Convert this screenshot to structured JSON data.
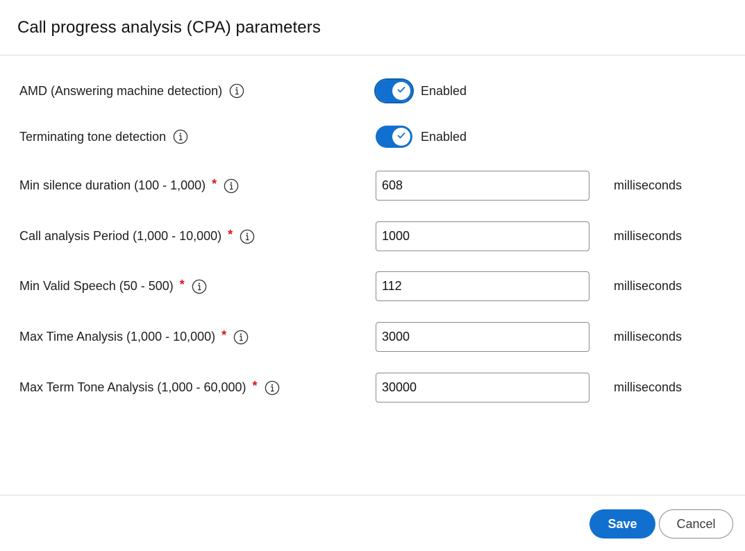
{
  "dialog": {
    "title": "Call progress analysis (CPA) parameters"
  },
  "toggles": [
    {
      "label": "AMD (Answering machine detection)",
      "state_text": "Enabled",
      "enabled": true
    },
    {
      "label": "Terminating tone detection",
      "state_text": "Enabled",
      "enabled": true
    }
  ],
  "fields": [
    {
      "label": "Min silence duration (100 - 1,000)",
      "required_mark": "*",
      "value": "608",
      "unit": "milliseconds"
    },
    {
      "label": "Call analysis Period (1,000 - 10,000)",
      "required_mark": "*",
      "value": "1000",
      "unit": "milliseconds"
    },
    {
      "label": "Min Valid Speech (50 - 500)",
      "required_mark": "*",
      "value": "112",
      "unit": "milliseconds"
    },
    {
      "label": "Max Time Analysis (1,000 - 10,000)",
      "required_mark": "*",
      "value": "3000",
      "unit": "milliseconds"
    },
    {
      "label": "Max Term Tone Analysis (1,000 - 60,000)",
      "required_mark": "*",
      "value": "30000",
      "unit": "milliseconds"
    }
  ],
  "footer": {
    "save_label": "Save",
    "cancel_label": "Cancel"
  },
  "icons": {
    "info": "info-icon",
    "check": "check-icon"
  },
  "colors": {
    "accent": "#1170cf",
    "required": "#d4191c",
    "border": "#8a8a8a"
  }
}
